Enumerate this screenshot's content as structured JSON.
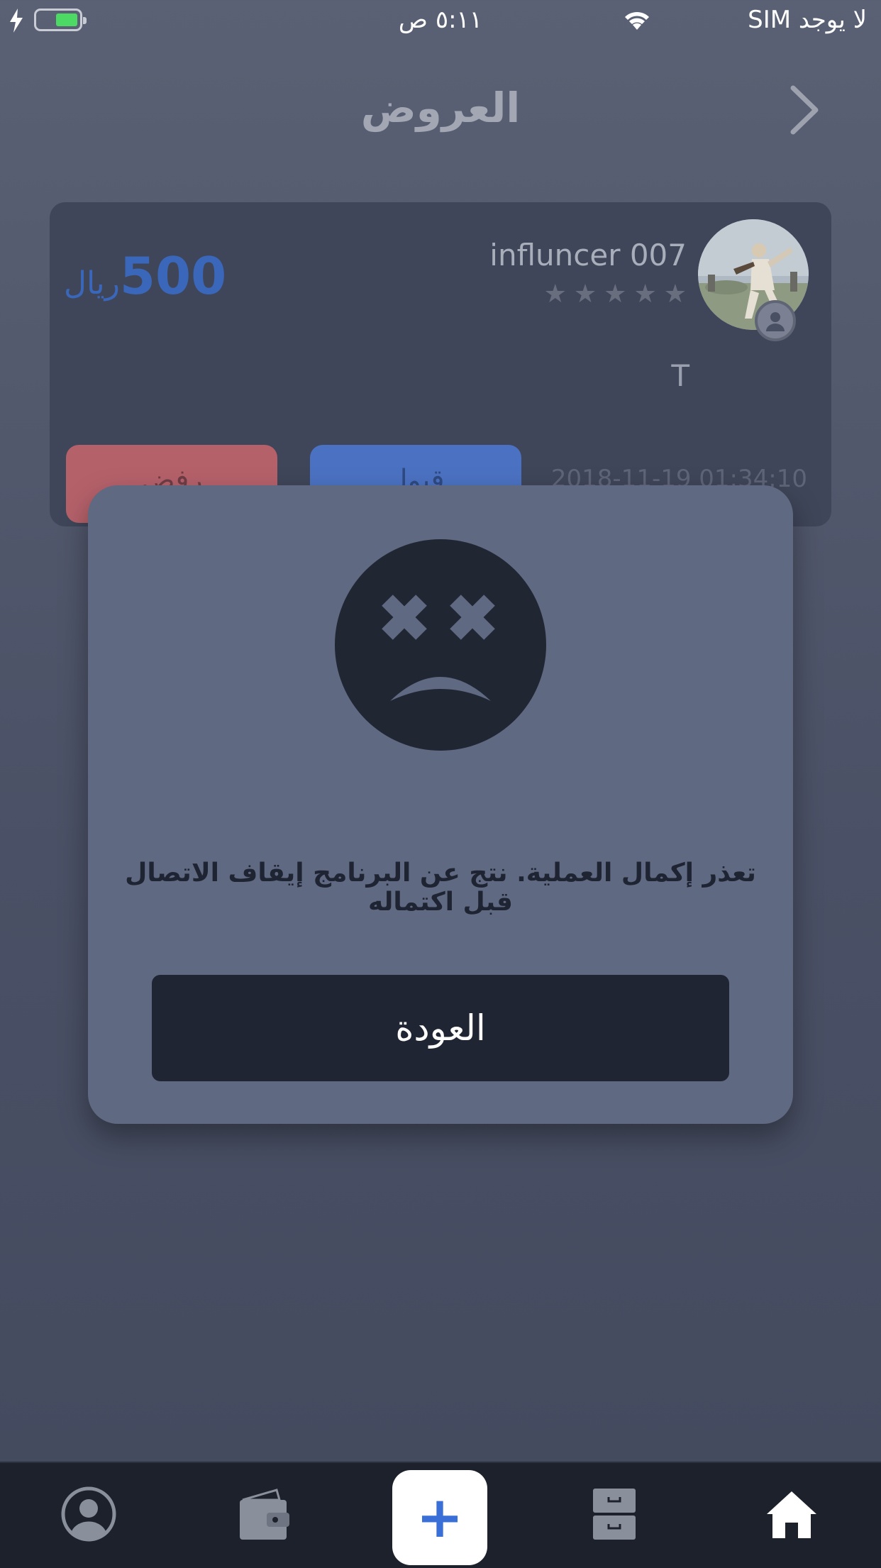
{
  "status_bar": {
    "carrier": "لا يوجد SIM",
    "time": "٥:١١ ص",
    "battery_level": 0.45
  },
  "nav": {
    "title": "العروض",
    "back_icon": "chevron-right-icon"
  },
  "offer": {
    "username": "influncer 007",
    "rating_stars": 5,
    "rating_value": 0,
    "price_amount": "500",
    "price_currency": "ريال",
    "message": "T",
    "reject_label": "رفض",
    "accept_label": "قبول",
    "timestamp": "2018-11-19 01:34:10"
  },
  "modal": {
    "icon": "sad-face-icon",
    "message": "تعذر إكمال العملية. نتج عن البرنامج إيقاف الاتصال قبل اكتماله",
    "button_label": "العودة"
  },
  "tab_bar": {
    "items": [
      "profile-icon",
      "wallet-icon",
      "add-icon",
      "archive-icon",
      "home-icon"
    ],
    "add_label": "+"
  },
  "colors": {
    "accent": "#3a67b9",
    "reject": "#b5616a",
    "modal_bg": "#5f6982",
    "dark": "#202534"
  }
}
